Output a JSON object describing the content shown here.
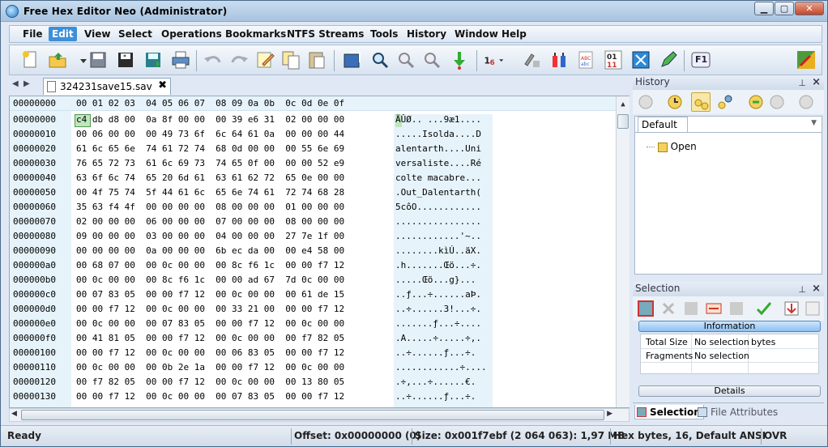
{
  "window": {
    "title": "Free Hex Editor Neo (Administrator)"
  },
  "menu": [
    "File",
    "Edit",
    "View",
    "Select",
    "Operations",
    "Bookmarks",
    "NTFS Streams",
    "Tools",
    "History",
    "Window",
    "Help"
  ],
  "menu_active": "Edit",
  "toolbar": {
    "icons": [
      "new-file-icon",
      "open-folder-icon",
      "dropdown-arrow-icon",
      "save-icon",
      "save-as-icon",
      "save-all-icon",
      "print-icon",
      "undo-icon",
      "redo-icon",
      "edit-icon",
      "copy-icon",
      "paste-icon",
      "export-icon",
      "find-icon",
      "find-next-icon",
      "find-prev-icon",
      "goto-icon",
      "bytes-group-icon",
      "bookmark-icon",
      "structure-icon",
      "encoding-icon",
      "binary-icon",
      "fullscreen-icon",
      "pen-icon",
      "f1-help-icon",
      "palette-icon"
    ],
    "f1_label": "F1"
  },
  "tab": {
    "filename": "324231save15.sav",
    "close": "✖"
  },
  "hex": {
    "header_offset": "00000000",
    "header_cols": "00 01 02 03  04 05 06 07  08 09 0a 0b  0c 0d 0e 0f",
    "rows": [
      {
        "off": "00000000",
        "hex": "c4 db d8 00  0a 8f 00 00  00 39 e6 31  02 00 00 00",
        "asc": "ÄÛØ.. ...9æ1...."
      },
      {
        "off": "00000010",
        "hex": "00 06 00 00  00 49 73 6f  6c 64 61 0a  00 00 00 44",
        "asc": ".....Isolda....D"
      },
      {
        "off": "00000020",
        "hex": "61 6c 65 6e  74 61 72 74  68 0d 00 00  00 55 6e 69",
        "asc": "alentarth....Uni"
      },
      {
        "off": "00000030",
        "hex": "76 65 72 73  61 6c 69 73  74 65 0f 00  00 00 52 e9",
        "asc": "versaliste....Ré"
      },
      {
        "off": "00000040",
        "hex": "63 6f 6c 74  65 20 6d 61  63 61 62 72  65 0e 00 00",
        "asc": "colte macabre..."
      },
      {
        "off": "00000050",
        "hex": "00 4f 75 74  5f 44 61 6c  65 6e 74 61  72 74 68 28",
        "asc": ".Out_Dalentarth("
      },
      {
        "off": "00000060",
        "hex": "35 63 f4 4f  00 00 00 00  08 00 00 00  01 00 00 00",
        "asc": "5côO............"
      },
      {
        "off": "00000070",
        "hex": "02 00 00 00  06 00 00 00  07 00 00 00  08 00 00 00",
        "asc": "................"
      },
      {
        "off": "00000080",
        "hex": "09 00 00 00  03 00 00 00  04 00 00 00  27 7e 1f 00",
        "asc": "............'~.."
      },
      {
        "off": "00000090",
        "hex": "00 00 00 00  0a 00 00 00  6b ec da 00  00 e4 58 00",
        "asc": "........kìÚ..äX."
      },
      {
        "off": "000000a0",
        "hex": "00 68 07 00  00 0c 00 00  00 8c f6 1c  00 00 f7 12",
        "asc": ".h.......Œö...÷."
      },
      {
        "off": "000000b0",
        "hex": "00 0c 00 00  00 8c f6 1c  00 00 ad 67  7d 0c 00 00",
        "asc": ".....Œö...­g}..."
      },
      {
        "off": "000000c0",
        "hex": "00 07 83 05  00 00 f7 12  00 0c 00 00  00 61 de 15",
        "asc": "..ƒ...÷......aÞ."
      },
      {
        "off": "000000d0",
        "hex": "00 00 f7 12  00 0c 00 00  00 33 21 00  00 00 f7 12",
        "asc": "..÷......3!...÷."
      },
      {
        "off": "000000e0",
        "hex": "00 0c 00 00  00 07 83 05  00 00 f7 12  00 0c 00 00",
        "asc": ".......ƒ...÷...."
      },
      {
        "off": "000000f0",
        "hex": "00 41 81 05  00 00 f7 12  00 0c 00 00  00 f7 82 05",
        "asc": ".A.....÷.....÷‚."
      },
      {
        "off": "00000100",
        "hex": "00 00 f7 12  00 0c 00 00  00 06 83 05  00 00 f7 12",
        "asc": "..÷......ƒ...÷."
      },
      {
        "off": "00000110",
        "hex": "00 0c 00 00  00 0b 2e 1a  00 00 f7 12  00 0c 00 00",
        "asc": "............÷...."
      },
      {
        "off": "00000120",
        "hex": "00 f7 82 05  00 00 f7 12  00 0c 00 00  00 13 80 05",
        "asc": ".÷‚...÷......€."
      },
      {
        "off": "00000130",
        "hex": "00 00 f7 12  00 0c 00 00  00 07 83 05  00 00 f7 12",
        "asc": "..÷......ƒ...÷."
      }
    ]
  },
  "history": {
    "title": "History",
    "tab_default": "Default",
    "item_open": "Open"
  },
  "selection": {
    "title": "Selection",
    "info_button": "Information",
    "details_button": "Details",
    "total_size_label": "Total Size",
    "total_size_value": "No selection",
    "total_size_unit": "bytes",
    "fragments_label": "Fragments",
    "fragments_value": "No selection"
  },
  "bottom_tabs": {
    "selection": "Selection",
    "file_attributes": "File Attributes"
  },
  "status": {
    "ready": "Ready",
    "offset": "Offset: 0x00000000 (0)",
    "size": "Size: 0x001f7ebf (2 064 063): 1,97 MB",
    "mode": "Hex bytes, 16, Default ANSI",
    "ovr": "OVR"
  },
  "colors": {
    "accent": "#3d8fd9",
    "offset_bg": "#e6f3fa",
    "cursor": "#bfe6bf"
  }
}
